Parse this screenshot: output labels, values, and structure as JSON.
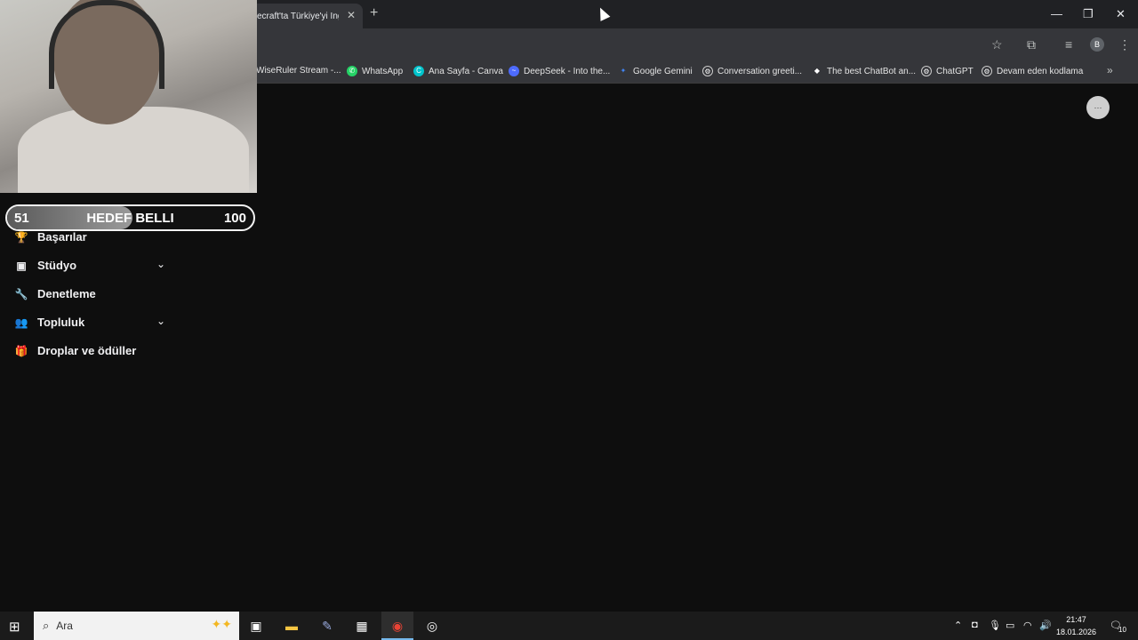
{
  "browser": {
    "tab_title": "ecraft'ta Türkiye'yi İng",
    "tab_close": "✕",
    "new_tab": "+",
    "window_controls": {
      "minimize": "—",
      "restore": "❐",
      "close": "✕"
    },
    "profile_initial": "B",
    "bookmarks": [
      {
        "label": "WiseRuler Stream -...",
        "icon": "twitch-icon"
      },
      {
        "label": "WhatsApp",
        "icon": "whatsapp-icon",
        "color": "#25d366"
      },
      {
        "label": "Ana Sayfa - Canva",
        "icon": "canva-icon",
        "color": "#00c4cc"
      },
      {
        "label": "DeepSeek - Into the...",
        "icon": "deepseek-icon",
        "color": "#4d6bfe"
      },
      {
        "label": "Google Gemini",
        "icon": "gemini-icon",
        "color": "#4285f4"
      },
      {
        "label": "Conversation greeti...",
        "icon": "chatgpt-icon"
      },
      {
        "label": "The best ChatBot an...",
        "icon": "chatbot-icon"
      },
      {
        "label": "ChatGPT",
        "icon": "chatgpt-icon"
      },
      {
        "label": "Devam eden kodlama",
        "icon": "chatgpt-icon"
      }
    ],
    "bookmarks_more": "»"
  },
  "goal": {
    "current": "51",
    "label": "HEDEF BELLI",
    "target": "100",
    "progress": 0.51
  },
  "sidebar": {
    "items": [
      {
        "label": "Başarılar",
        "icon": "trophy-icon",
        "glyph": "🏆",
        "expandable": false
      },
      {
        "label": "Stüdyo",
        "icon": "studio-icon",
        "glyph": "▣",
        "expandable": true
      },
      {
        "label": "Denetleme",
        "icon": "wrench-icon",
        "glyph": "🔧",
        "expandable": false
      },
      {
        "label": "Topluluk",
        "icon": "community-icon",
        "glyph": "👥",
        "expandable": true
      },
      {
        "label": "Droplar ve ödüller",
        "icon": "drops-icon",
        "glyph": "🎁",
        "expandable": false
      }
    ],
    "chevron": "⌄"
  },
  "taskbar": {
    "search_placeholder": "Ara",
    "clock_time": "21:47",
    "clock_date": "18.01.2026",
    "notification_count": "10"
  }
}
